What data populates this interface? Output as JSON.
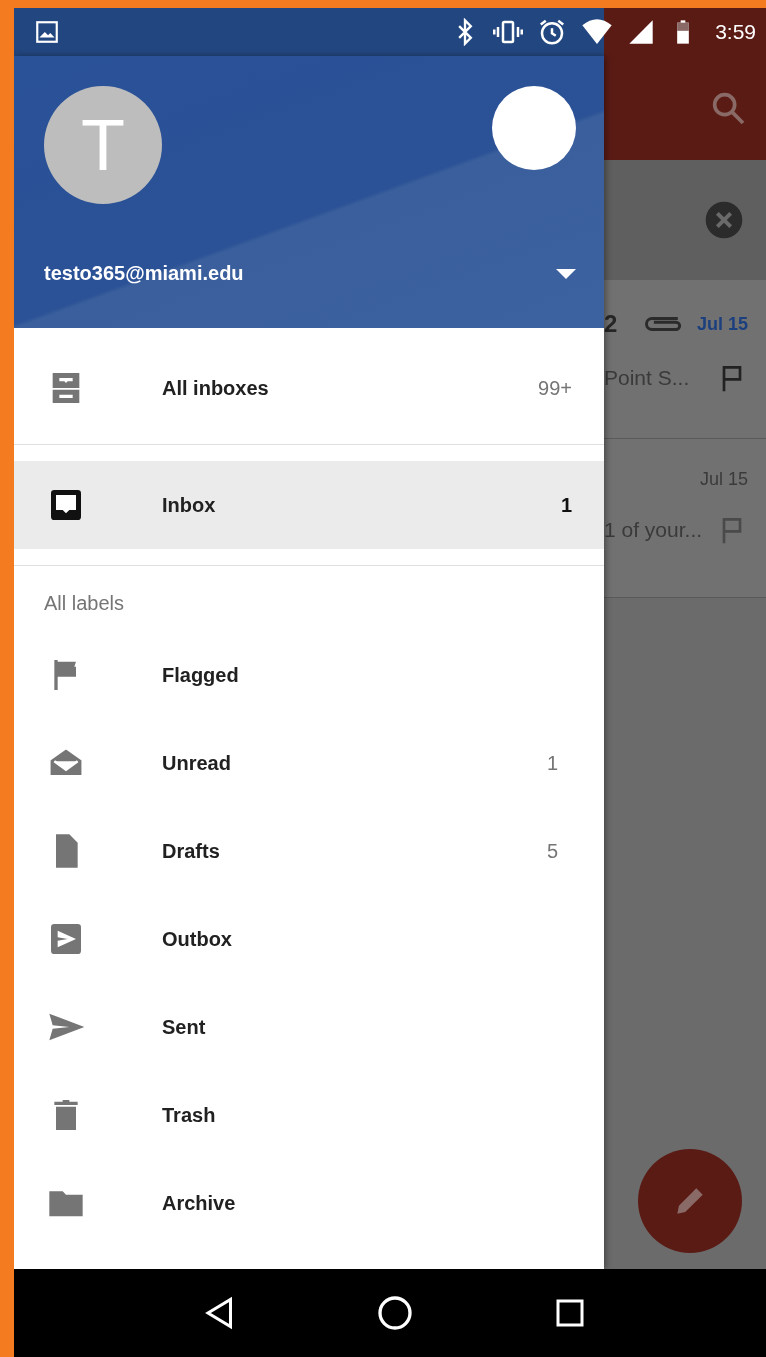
{
  "status_bar": {
    "time": "3:59"
  },
  "account": {
    "avatar_letter": "T",
    "email": "testo365@miami.edu"
  },
  "mailboxes": [
    {
      "label": "All inboxes",
      "count": "99+",
      "selected": false
    },
    {
      "label": "Inbox",
      "count": "1",
      "selected": true
    }
  ],
  "labels_heading": "All labels",
  "labels": [
    {
      "label": "Flagged"
    },
    {
      "label": "Unread",
      "count": "1"
    },
    {
      "label": "Drafts",
      "count": "5"
    },
    {
      "label": "Outbox"
    },
    {
      "label": "Sent"
    },
    {
      "label": "Trash"
    },
    {
      "label": "Archive"
    }
  ],
  "background_list": [
    {
      "column_1": "2",
      "date": "Jul 15",
      "snippet": "Point S...",
      "unread": true,
      "attachment": true
    },
    {
      "date": "Jul 15",
      "snippet": "1 of your...",
      "unread": false,
      "attachment": false
    }
  ]
}
